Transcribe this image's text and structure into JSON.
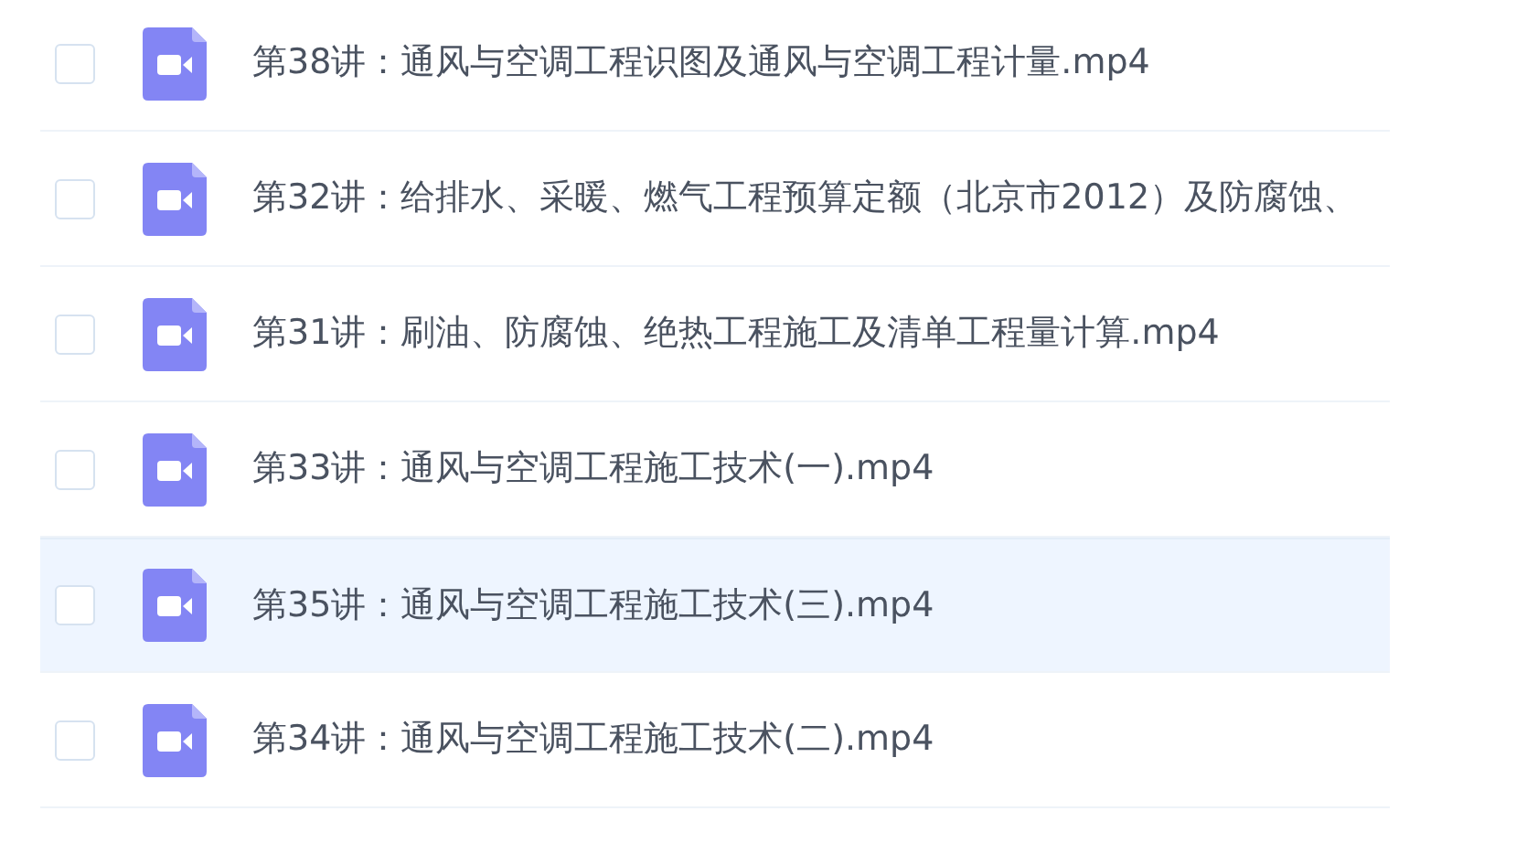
{
  "files": [
    {
      "title": "第38讲：通风与空调工程识图及通风与空调工程计量.mp4",
      "checked": false,
      "highlighted": false
    },
    {
      "title": "第32讲：给排水、采暖、燃气工程预算定额（北京市2012）及防腐蚀、",
      "checked": false,
      "highlighted": false
    },
    {
      "title": "第31讲：刷油、防腐蚀、绝热工程施工及清单工程量计算.mp4",
      "checked": false,
      "highlighted": false
    },
    {
      "title": "第33讲：通风与空调工程施工技术(一).mp4",
      "checked": false,
      "highlighted": false
    },
    {
      "title": "第35讲：通风与空调工程施工技术(三).mp4",
      "checked": false,
      "highlighted": true
    },
    {
      "title": "第34讲：通风与空调工程施工技术(二).mp4",
      "checked": false,
      "highlighted": false
    }
  ]
}
